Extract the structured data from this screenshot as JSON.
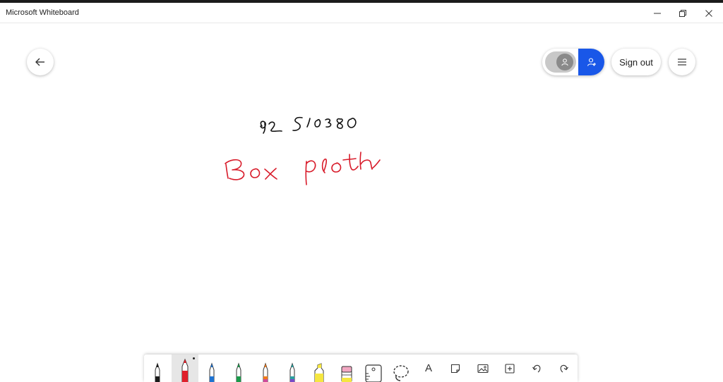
{
  "window": {
    "title": "Microsoft Whiteboard",
    "controls": [
      "minimize",
      "restore",
      "close"
    ]
  },
  "header": {
    "back_icon": "arrow-left-icon",
    "sign_out_label": "Sign out",
    "menu_icon": "hamburger-icon",
    "accent_color": "#1957e8"
  },
  "canvas": {
    "handwriting": [
      {
        "text": "Box plot",
        "color": "#d81b2a"
      }
    ]
  },
  "toolbar": {
    "tools": [
      {
        "name": "pen-black",
        "color": "#1a1a1a",
        "selected": false
      },
      {
        "name": "pen-red",
        "color": "#e0202b",
        "selected": true
      },
      {
        "name": "pen-blue",
        "color": "#1e73d2",
        "selected": false
      },
      {
        "name": "pen-green",
        "color": "#1a9a4a",
        "selected": false
      },
      {
        "name": "pen-orange",
        "color": "#f07b1a",
        "selected": false
      },
      {
        "name": "pen-galaxy",
        "color": "#2aa0a0",
        "selected": false
      },
      {
        "name": "highlighter",
        "color": "#f5e640",
        "selected": false
      },
      {
        "name": "eraser",
        "color": "#f2a7c2",
        "selected": false
      },
      {
        "name": "ruler",
        "selected": false
      },
      {
        "name": "lasso",
        "selected": false
      },
      {
        "name": "text",
        "label": "A",
        "selected": false
      },
      {
        "name": "note",
        "selected": false
      },
      {
        "name": "image",
        "selected": false
      },
      {
        "name": "insert",
        "selected": false
      },
      {
        "name": "undo",
        "selected": false
      },
      {
        "name": "redo",
        "selected": false
      }
    ]
  }
}
